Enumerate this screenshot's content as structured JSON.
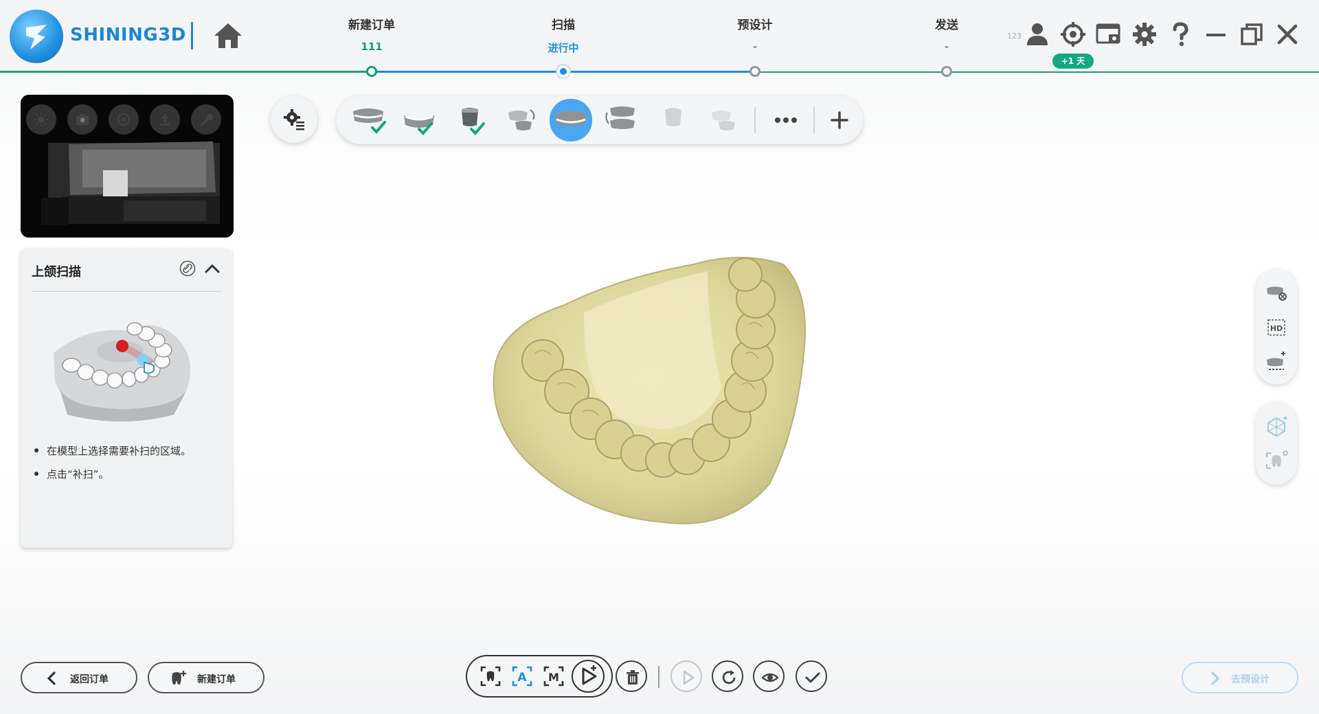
{
  "brand": {
    "name": "SHINING3D",
    "color": "#1b86d8",
    "accent_green": "#11a981",
    "accent_blue": "#1a8fe0"
  },
  "steps": [
    {
      "title": "新建订单",
      "sub": "111",
      "state": "done"
    },
    {
      "title": "扫描",
      "sub": "进行中",
      "state": "active"
    },
    {
      "title": "预设计",
      "sub": "-",
      "state": "todo"
    },
    {
      "title": "发送",
      "sub": "-",
      "state": "todo"
    }
  ],
  "topbar": {
    "small_label": "123",
    "days_badge": "+1 天",
    "icons": [
      "user-icon",
      "target-icon",
      "screenshot-icon",
      "settings-gear-icon",
      "help-icon",
      "minimize-icon",
      "restore-icon",
      "close-icon"
    ]
  },
  "camera": {
    "buttons": [
      "brightness-icon",
      "camera-capture-icon",
      "reset-icon",
      "upload-icon",
      "wrench-icon"
    ]
  },
  "guide_panel": {
    "title": "上颌扫描",
    "instructions": [
      "在模型上选择需要补扫的区域。",
      "点击“补扫”。"
    ]
  },
  "scan_toolbar": {
    "items": [
      {
        "name": "upper-jaw-scan-icon",
        "state": "done"
      },
      {
        "name": "lower-jaw-scan-icon",
        "state": "done"
      },
      {
        "name": "die-scan-icon",
        "state": "done"
      },
      {
        "name": "bite-align-icon",
        "state": "normal"
      },
      {
        "name": "upper-jaw-rescan-icon",
        "state": "active"
      },
      {
        "name": "jaw-stack-icon",
        "state": "normal"
      },
      {
        "name": "die-faded-icon",
        "state": "disabled"
      },
      {
        "name": "bite-faded-icon",
        "state": "disabled"
      },
      {
        "name": "more-icon",
        "state": "normal"
      },
      {
        "name": "add-icon",
        "state": "normal"
      }
    ]
  },
  "side_tools": {
    "top": [
      "texture-toggle-icon",
      "hd-icon",
      "clip-scan-icon"
    ],
    "bottom": [
      "mesh-view-icon",
      "tooth-view-icon"
    ]
  },
  "bottom": {
    "back_label": "返回订单",
    "new_order_label": "新建订单",
    "next_label": "去预设计",
    "actions": [
      "select-region-icon",
      "auto-select-icon",
      "manual-select-icon",
      "rescan-play-icon",
      "delete-icon",
      "play-icon",
      "rotate-icon",
      "view-icon",
      "confirm-icon"
    ]
  }
}
